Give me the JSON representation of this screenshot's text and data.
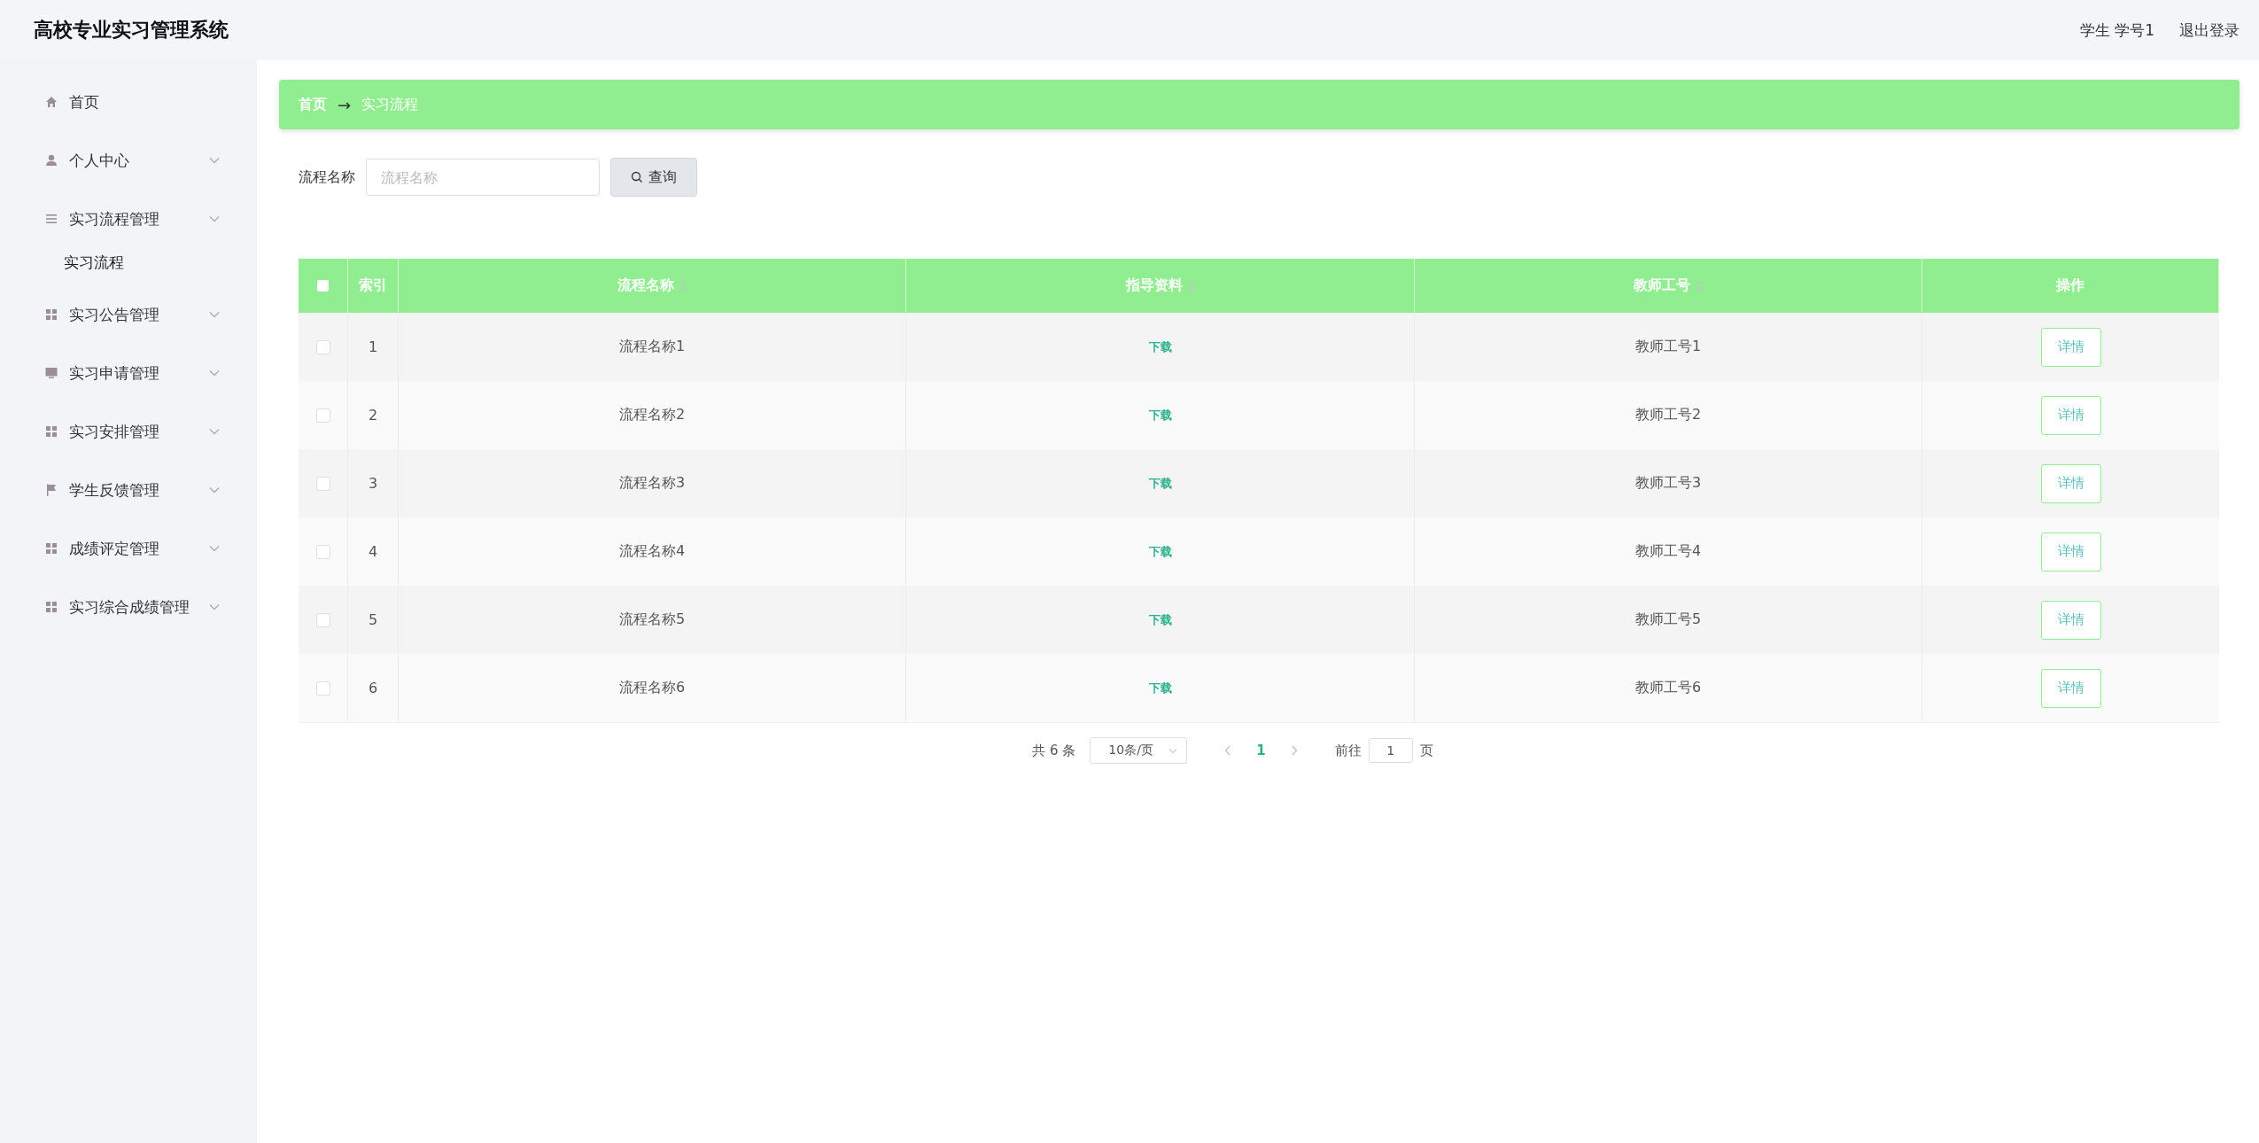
{
  "header": {
    "title": "高校专业实习管理系统",
    "user": "学生 学号1",
    "logout": "退出登录"
  },
  "sidebar": {
    "items": [
      {
        "label": "首页",
        "kind": "home",
        "has_caret": false
      },
      {
        "label": "个人中心",
        "kind": "user",
        "has_caret": true
      },
      {
        "label": "实习流程管理",
        "kind": "list",
        "has_caret": true,
        "children": [
          {
            "label": "实习流程"
          }
        ]
      },
      {
        "label": "实习公告管理",
        "kind": "grid",
        "has_caret": true
      },
      {
        "label": "实习申请管理",
        "kind": "monitor",
        "has_caret": true
      },
      {
        "label": "实习安排管理",
        "kind": "grid",
        "has_caret": true
      },
      {
        "label": "学生反馈管理",
        "kind": "flag",
        "has_caret": true
      },
      {
        "label": "成绩评定管理",
        "kind": "grid",
        "has_caret": true
      },
      {
        "label": "实习综合成绩管理",
        "kind": "grid",
        "has_caret": true
      }
    ]
  },
  "breadcrumb": {
    "home": "首页",
    "separator": "→",
    "current": "实习流程"
  },
  "search": {
    "label": "流程名称",
    "placeholder": "流程名称",
    "button": "查询"
  },
  "table": {
    "select_all_checked": false,
    "columns": [
      {
        "label": "索引",
        "kind": "plain"
      },
      {
        "label": "流程名称",
        "kind": "sortable"
      },
      {
        "label": "指导资料",
        "kind": "sortable"
      },
      {
        "label": "教师工号",
        "kind": "sortable"
      },
      {
        "label": "操作",
        "kind": "plain"
      }
    ],
    "rows": [
      {
        "checked": false,
        "index": "1",
        "name": "流程名称1",
        "material": "下载",
        "teacher": "教师工号1",
        "action": "详情"
      },
      {
        "checked": false,
        "index": "2",
        "name": "流程名称2",
        "material": "下载",
        "teacher": "教师工号2",
        "action": "详情"
      },
      {
        "checked": false,
        "index": "3",
        "name": "流程名称3",
        "material": "下载",
        "teacher": "教师工号3",
        "action": "详情"
      },
      {
        "checked": false,
        "index": "4",
        "name": "流程名称4",
        "material": "下载",
        "teacher": "教师工号4",
        "action": "详情"
      },
      {
        "checked": false,
        "index": "5",
        "name": "流程名称5",
        "material": "下载",
        "teacher": "教师工号5",
        "action": "详情"
      },
      {
        "checked": false,
        "index": "6",
        "name": "流程名称6",
        "material": "下载",
        "teacher": "教师工号6",
        "action": "详情"
      }
    ]
  },
  "pagination": {
    "total": "共 6 条",
    "page_size": "10条/页",
    "pages": [
      {
        "label": "1",
        "selected": true
      }
    ],
    "goto_label": "前往",
    "goto_value": "1",
    "goto_suffix": "页"
  }
}
